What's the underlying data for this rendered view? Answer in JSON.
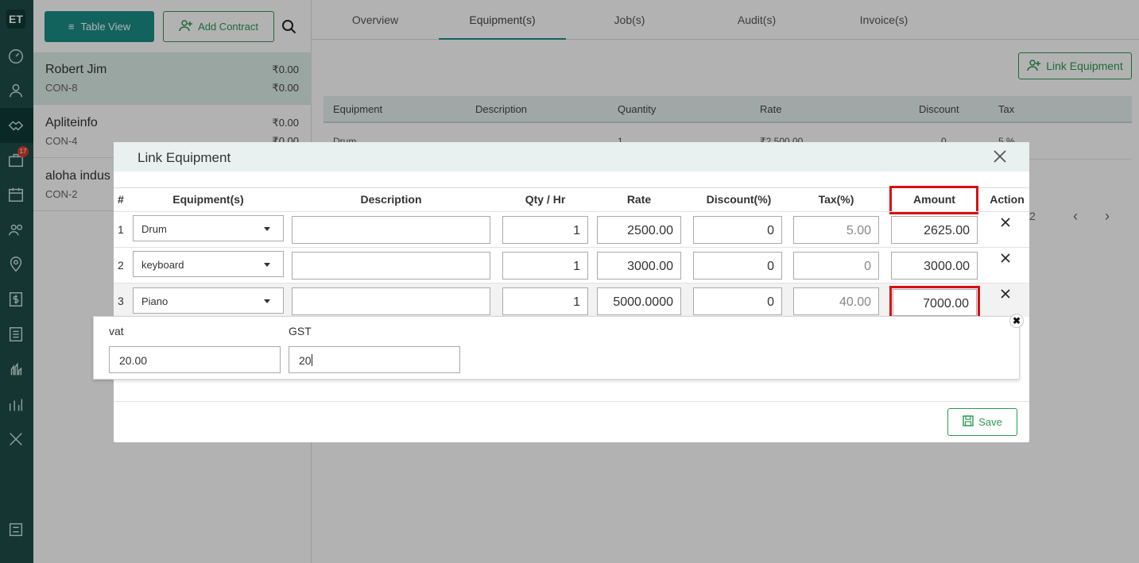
{
  "app": {
    "logo_text": "ET",
    "notification_count": "17"
  },
  "rail_icons": [
    "dashboard-icon",
    "user-icon",
    "handshake-icon",
    "briefcase-icon",
    "calendar-icon",
    "team-icon",
    "location-icon",
    "dollar-icon",
    "list-icon",
    "leads-icon",
    "chart-icon",
    "tools-icon",
    "settings-icon"
  ],
  "toolbar": {
    "table_view_label": "Table View",
    "add_contract_label": "Add Contract"
  },
  "contracts": [
    {
      "name": "Robert Jim",
      "code": "CON-8",
      "amount1": "₹0.00",
      "amount2": "₹0.00"
    },
    {
      "name": "Apliteinfo",
      "code": "CON-4",
      "amount1": "₹0.00",
      "amount2": "₹0.00"
    },
    {
      "name": "aloha indus",
      "code": "CON-2",
      "amount1": "",
      "amount2": ""
    }
  ],
  "tabs": [
    "Overview",
    "Equipment(s)",
    "Job(s)",
    "Audit(s)",
    "Invoice(s)"
  ],
  "active_tab": "Equipment(s)",
  "link_equipment_label": "Link Equipment",
  "bg_table": {
    "headers": [
      "Equipment",
      "Description",
      "Quantity",
      "Rate",
      "Discount",
      "Tax"
    ],
    "row": [
      "Drum",
      "1",
      "₹2,500.00",
      "0",
      "5 %"
    ],
    "pager_text": "2"
  },
  "modal": {
    "title": "Link Equipment",
    "headers": [
      "#",
      "Equipment(s)",
      "Description",
      "Qty / Hr",
      "Rate",
      "Discount(%)",
      "Tax(%)",
      "Amount",
      "Action"
    ],
    "rows": [
      {
        "num": "1",
        "equipment": "Drum",
        "description": "",
        "qty": "1",
        "rate": "2500.00",
        "discount": "0",
        "tax": "5.00",
        "amount": "2625.00"
      },
      {
        "num": "2",
        "equipment": "keyboard",
        "description": "",
        "qty": "1",
        "rate": "3000.00",
        "discount": "0",
        "tax": "0",
        "amount": "3000.00"
      },
      {
        "num": "3",
        "equipment": "Piano",
        "description": "",
        "qty": "1",
        "rate": "5000.0000",
        "discount": "0",
        "tax": "40.00",
        "amount": "7000.00"
      }
    ],
    "tax_popover": {
      "vat_label": "vat",
      "vat_value": "20.00",
      "gst_label": "GST",
      "gst_value": "20"
    },
    "save_label": "Save",
    "highlight_color": "#d80f0f",
    "accent_color": "#1a8f86"
  }
}
